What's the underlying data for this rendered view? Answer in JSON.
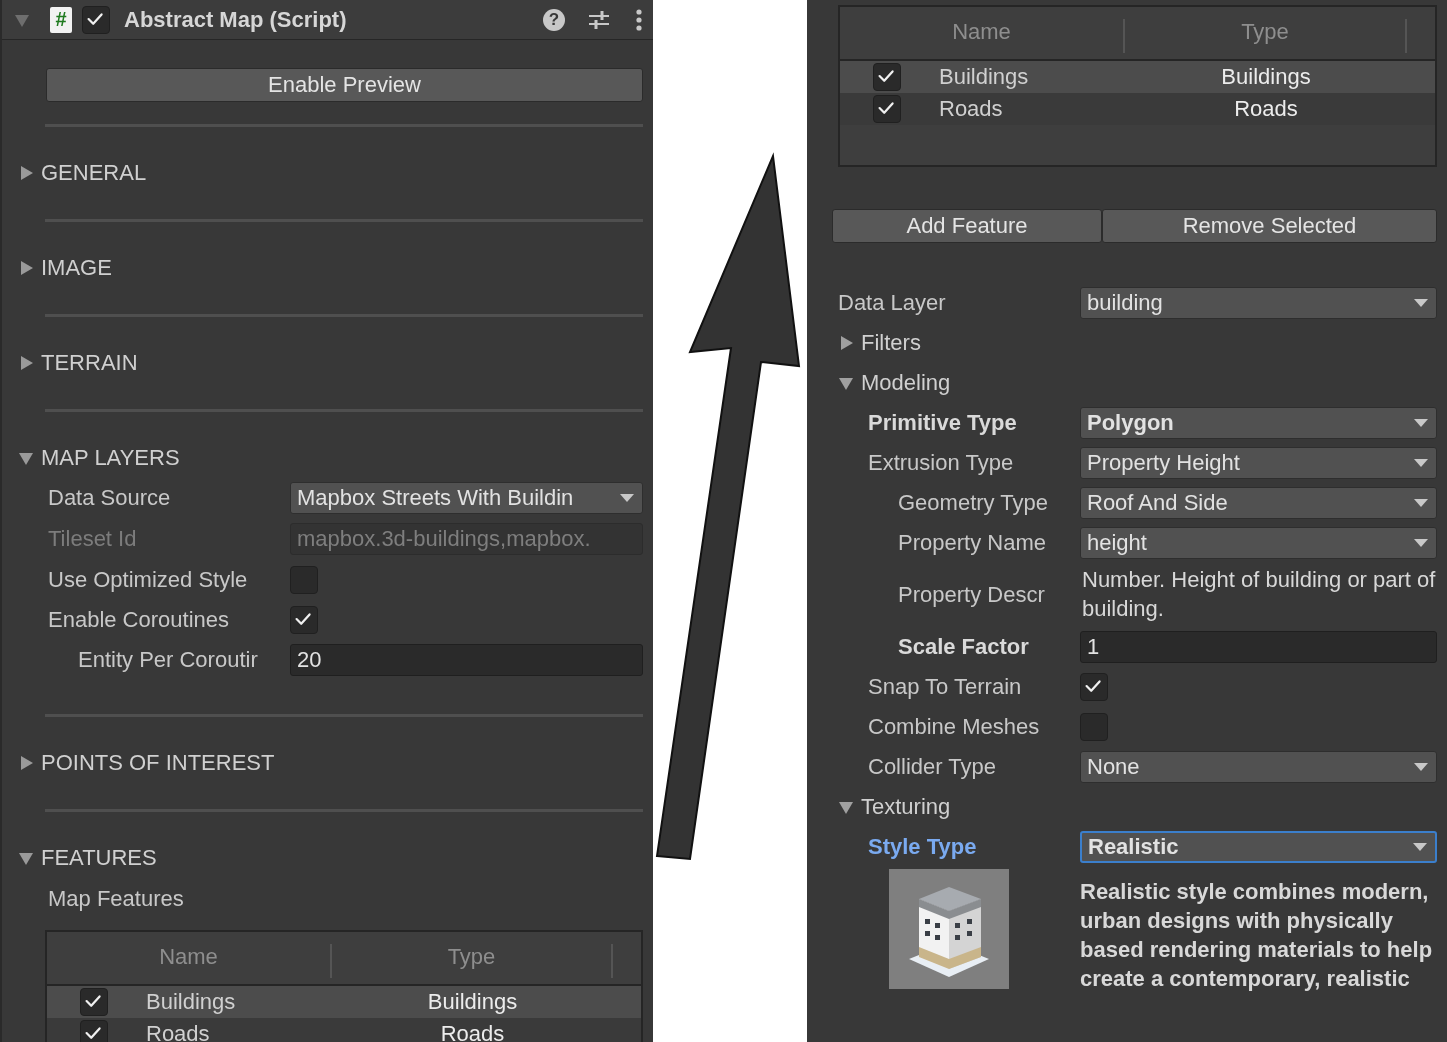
{
  "left_panel": {
    "header": {
      "expanded": true,
      "script_glyph": "#",
      "enabled": true,
      "title": "Abstract Map (Script)",
      "help_glyph": "?"
    },
    "preview_button": "Enable Preview",
    "sections": [
      {
        "label": "GENERAL",
        "expanded": false
      },
      {
        "label": "IMAGE",
        "expanded": false
      },
      {
        "label": "TERRAIN",
        "expanded": false
      },
      {
        "label": "MAP LAYERS",
        "expanded": true,
        "fields": [
          {
            "kind": "dropdown",
            "label": "Data Source",
            "value": "Mapbox Streets With Buildin"
          },
          {
            "kind": "text",
            "label": "Tileset Id",
            "value": "mapbox.3d-buildings,mapbox.",
            "disabled": true
          },
          {
            "kind": "checkbox",
            "label": "Use Optimized Style",
            "checked": false
          },
          {
            "kind": "checkbox",
            "label": "Enable Coroutines",
            "checked": true,
            "children": [
              {
                "kind": "number",
                "label": "Entity Per Coroutir",
                "value": "20"
              }
            ]
          }
        ]
      },
      {
        "label": "POINTS OF INTEREST",
        "expanded": false
      },
      {
        "label": "FEATURES",
        "expanded": true,
        "fields": [
          {
            "kind": "label",
            "label": "Map Features"
          },
          {
            "kind": "table",
            "columns": [
              "Name",
              "Type"
            ],
            "rows": [
              {
                "checked": true,
                "name": "Buildings",
                "type": "Buildings"
              },
              {
                "checked": true,
                "name": "Roads",
                "type": "Roads"
              }
            ]
          }
        ]
      }
    ]
  },
  "right_panel": {
    "table": {
      "columns": [
        "Name",
        "Type"
      ],
      "rows": [
        {
          "checked": true,
          "name": "Buildings",
          "type": "Buildings"
        },
        {
          "checked": true,
          "name": "Roads",
          "type": "Roads"
        }
      ]
    },
    "buttons": [
      "Add Feature",
      "Remove Selected"
    ],
    "fields": [
      {
        "kind": "dropdown",
        "label": "Data Layer",
        "value": "building"
      },
      {
        "kind": "foldout",
        "label": "Filters",
        "expanded": false
      },
      {
        "kind": "foldout",
        "label": "Modeling",
        "expanded": true,
        "children": [
          {
            "kind": "dropdown",
            "label": "Primitive Type",
            "value": "Polygon",
            "bold": true
          },
          {
            "kind": "dropdown",
            "label": "Extrusion Type",
            "value": "Property Height",
            "children": [
              {
                "kind": "dropdown",
                "label": "Geometry Type",
                "value": "Roof And Side"
              },
              {
                "kind": "dropdown",
                "label": "Property Name",
                "value": "height"
              },
              {
                "kind": "description",
                "label": "Property Descr",
                "value": "Number. Height of building or part of building."
              },
              {
                "kind": "number",
                "label": "Scale Factor",
                "value": "1",
                "bold": true
              }
            ]
          },
          {
            "kind": "checkbox",
            "label": "Snap To Terrain",
            "checked": true
          },
          {
            "kind": "checkbox",
            "label": "Combine Meshes",
            "checked": false
          },
          {
            "kind": "dropdown",
            "label": "Collider Type",
            "value": "None"
          }
        ]
      },
      {
        "kind": "foldout",
        "label": "Texturing",
        "expanded": true,
        "children": [
          {
            "kind": "dropdown",
            "label": "Style Type",
            "value": "Realistic",
            "bold": true,
            "focused": true
          },
          {
            "kind": "preview",
            "value": "Realistic style combines modern, urban designs with physically based rendering materials to help create a contemporary, realistic"
          }
        ]
      }
    ]
  }
}
